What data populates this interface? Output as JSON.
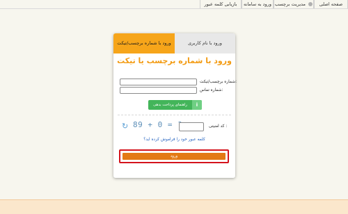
{
  "topnav": {
    "tabs": [
      {
        "label": "صفحه اصلی"
      },
      {
        "label": "مدیریت برچسب"
      },
      {
        "label": "ورود به سامانه"
      },
      {
        "label": "بازیابی کلمه عبور"
      }
    ]
  },
  "login_card": {
    "tab_ticket": "ورود با شماره برچسب/تیکت",
    "tab_username": "ورود با نام کاربری",
    "title": "ورود با شماره برچسب یا تیکت",
    "ticket_label": "شماره برچسب/تیکت:",
    "ticket_value": "",
    "phone_label": "شماره تماس:",
    "phone_value": "",
    "guide_button": "راهنمای پرداخت بدهی",
    "captcha_label": "کد امنیتی :",
    "captcha_value": "",
    "captcha_text": "89 + 0 = ?",
    "forgot_link": "کلمه عبور خود را فراموش کرده اید؟",
    "login_button": "ورود"
  },
  "icons": {
    "guide": "info-icon",
    "refresh": "refresh-icon"
  },
  "colors": {
    "accent_orange": "#f6a51a",
    "title_orange": "#f39b12",
    "login_button": "#e37a14",
    "guide_green": "#43b55a",
    "highlight_red": "#d4141d",
    "link_blue": "#1f5fbf"
  }
}
